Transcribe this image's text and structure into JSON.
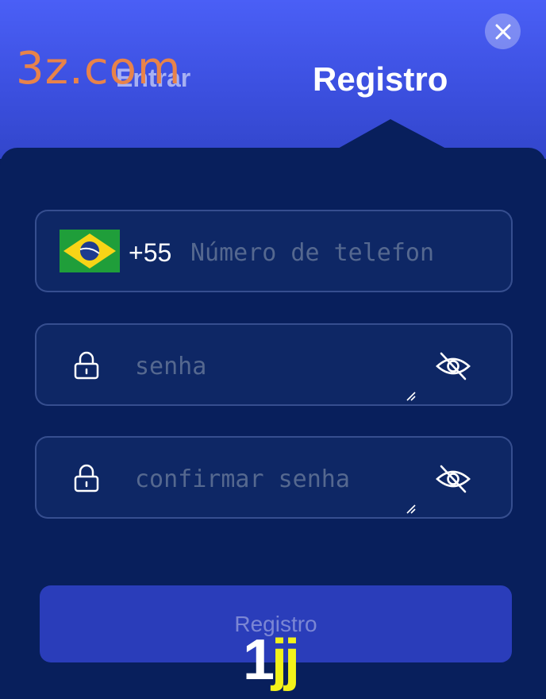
{
  "watermark": "3z.com",
  "tabs": {
    "login_label": "Entrar",
    "register_label": "Registro",
    "active": "register"
  },
  "form": {
    "phone": {
      "country": "Brazil",
      "prefix": "+55",
      "placeholder": "Número de telefon",
      "value": ""
    },
    "password": {
      "placeholder": "senha",
      "value": ""
    },
    "confirm_password": {
      "placeholder": "confirmar senha",
      "value": ""
    }
  },
  "submit_label": "Registro",
  "brand": {
    "part1": "1",
    "part2": "jj"
  },
  "colors": {
    "accent": "#3c50e0",
    "panel": "#081f5c",
    "button": "#2a3dba",
    "brand_yellow": "#f2f21a"
  },
  "icons": [
    "close-icon",
    "brazil-flag-icon",
    "lock-icon",
    "eye-off-icon"
  ]
}
